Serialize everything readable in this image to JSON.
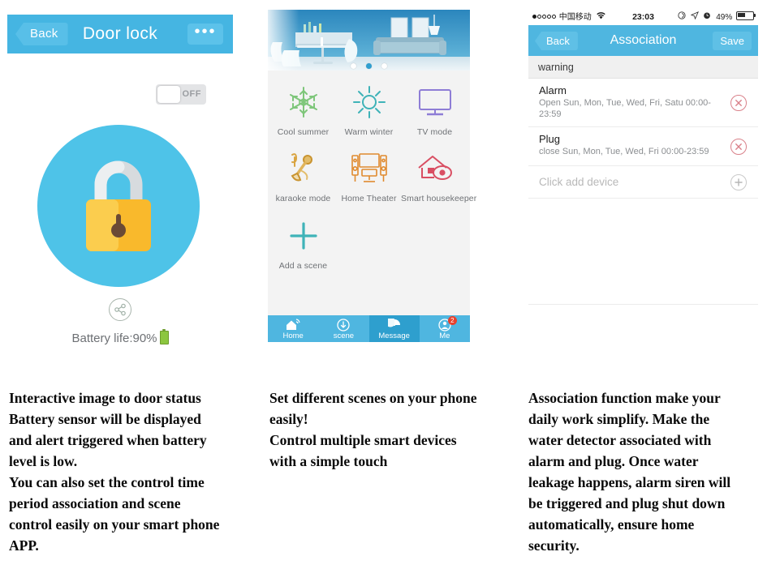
{
  "panel1": {
    "header": {
      "back_label": "Back",
      "title": "Door lock",
      "more_label": "•••"
    },
    "power_toggle": {
      "state_label": "OFF"
    },
    "lock_icon": "padlock-locked",
    "share_icon": "share-icon",
    "battery_text": "Battery life:90%"
  },
  "panel2": {
    "banner": {
      "alt": "blue living room photo",
      "dots": 3,
      "active_dot": 2
    },
    "scenes": [
      {
        "label": "Cool summer",
        "icon": "snowflake-icon",
        "color": "#7ec67a"
      },
      {
        "label": "Warm winter",
        "icon": "sun-icon",
        "color": "#3fb3b8"
      },
      {
        "label": "TV mode",
        "icon": "television-icon",
        "color": "#8e7dd6"
      },
      {
        "label": "karaoke mode",
        "icon": "microphone-icon",
        "color": "#d9a441"
      },
      {
        "label": "Home Theater",
        "icon": "home-theater-icon",
        "color": "#e08a2e"
      },
      {
        "label": "Smart housekeeper",
        "icon": "house-eye-icon",
        "color": "#d94f63"
      },
      {
        "label": "Add a scene",
        "icon": "plus-icon",
        "color": "#3fb3b8"
      }
    ],
    "tabs": [
      {
        "label": "Home",
        "icon": "home-wifi-icon",
        "active": false,
        "badge": ""
      },
      {
        "label": "scene",
        "icon": "scene-icon",
        "active": false,
        "badge": ""
      },
      {
        "label": "Message",
        "icon": "pie-chart-icon",
        "active": true,
        "badge": ""
      },
      {
        "label": "Me",
        "icon": "person-icon",
        "active": false,
        "badge": "2"
      }
    ]
  },
  "panel3": {
    "statusbar": {
      "carrier": "中国移动",
      "wifi_icon": "wifi-icon",
      "time": "23:03",
      "location_icon": "location-arrow-icon",
      "alarm_icon": "alarm-clock-icon",
      "lock_rotation_icon": "rotation-lock-icon",
      "battery_percent": "49%"
    },
    "header": {
      "back_label": "Back",
      "title": "Association",
      "save_label": "Save"
    },
    "section_header": "warning",
    "rows": [
      {
        "title": "Alarm",
        "subtitle": " Open  Sun, Mon, Tue, Wed, Fri, Satu 00:00-23:59",
        "action_icon": "remove-circle-icon",
        "action_color": "#d9818a"
      },
      {
        "title": "Plug",
        "subtitle": "close Sun, Mon, Tue, Wed, Fri 00:00-23:59",
        "action_icon": "remove-circle-icon",
        "action_color": "#d9818a"
      }
    ],
    "add_row": {
      "label": "Click add device",
      "action_icon": "add-circle-icon"
    }
  },
  "captions": {
    "caption1": "Interactive image to door status Battery sensor will be displayed and alert triggered when battery level is low.\nYou can also set the control time period association and scene control easily on your smart phone APP.",
    "caption1_lines": [
      "Interactive image to door status",
      "Battery sensor will be displayed",
      "and alert triggered when battery",
      "level is low.",
      "You can also set the control time",
      "period association and scene",
      "control easily on your smart phone",
      "APP."
    ],
    "caption2_lines": [
      "Set different scenes on your phone",
      "easily!",
      "Control multiple smart devices",
      "with a simple touch"
    ],
    "caption3_lines": [
      "Association function make your",
      "daily work simplify. Make the",
      "water detector associated with",
      "alarm and plug. Once water",
      "leakage happens, alarm siren will",
      "be triggered and plug shut down",
      "automatically, ensure home",
      "security."
    ]
  },
  "colors": {
    "header_blue": "#4fb6e0",
    "lock_circle_blue": "#4ec3e8",
    "lock_body_yellow": "#f6c council",
    "badge_red": "#e8412c",
    "delete_red": "#d9818a"
  }
}
